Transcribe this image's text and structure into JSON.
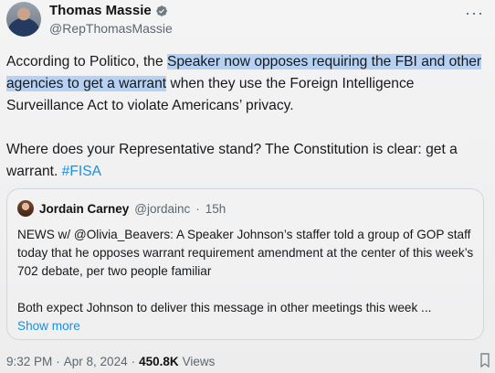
{
  "author": {
    "display_name": "Thomas Massie",
    "handle": "@RepThomasMassie"
  },
  "tweet": {
    "line1_before": "According to Politico, the ",
    "highlight": "Speaker now opposes requiring the FBI and other agencies to get a warrant",
    "line1_after": " when they use the Foreign Intelligence Surveillance Act to violate Americans’ privacy.",
    "para2": "Where does your Representative stand? The Constitution is clear: get a warrant. ",
    "hashtag": "#FISA"
  },
  "quote": {
    "display_name": "Jordain Carney",
    "handle": "@jordainc",
    "separator": "·",
    "time": "15h",
    "para1": "NEWS w/ @Olivia_Beavers: A Speaker Johnson’s staffer told a group of GOP staff today that he opposes warrant requirement amendment at the center of this week’s 702 debate, per two people familiar",
    "para2": "Both expect Johnson to deliver this message in other meetings this week ...",
    "show_more": "Show more"
  },
  "footer": {
    "time": "9:32 PM",
    "separator": "·",
    "date": "Apr 8, 2024",
    "separator2": "·",
    "views_count": "450.8K",
    "views_label": "Views"
  },
  "icons": {
    "more": "more-icon",
    "verified": "verified-badge-icon",
    "edge": "bookmark-icon"
  },
  "colors": {
    "highlight": "#b7d1f3",
    "link": "#1d8fe0",
    "verified": "#6f7b84"
  }
}
